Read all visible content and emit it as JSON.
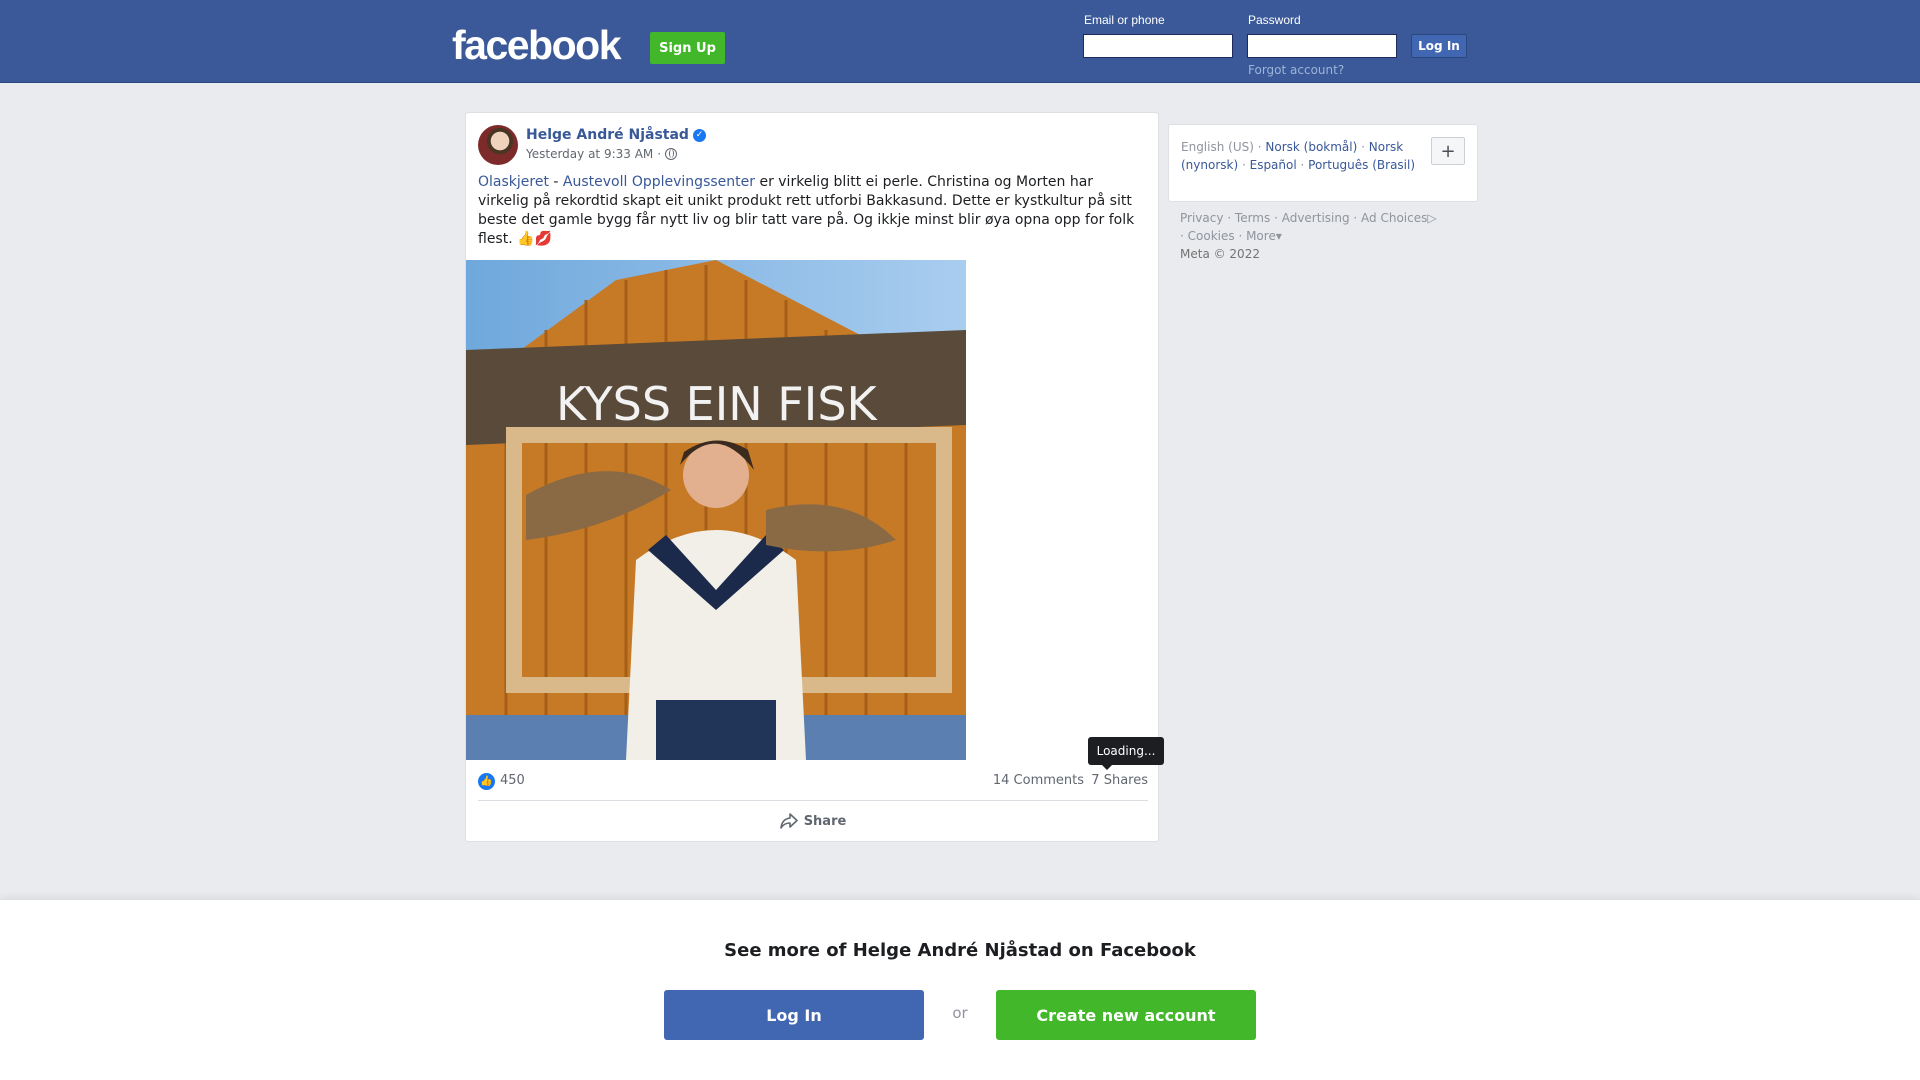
{
  "header": {
    "logo": "facebook",
    "signup_label": "Sign Up",
    "email_label": "Email or phone",
    "email_value": "",
    "password_label": "Password",
    "password_value": "",
    "login_label": "Log In",
    "forgot_label": "Forgot account?"
  },
  "post": {
    "author": "Helge André Njåstad",
    "verified_icon": "✓",
    "timestamp": "Yesterday at 9:33 AM",
    "meta_separator": "·",
    "text_link1": "Olaskjeret",
    "text_dash": " - ",
    "text_link2": "Austevoll Opplevingssenter",
    "text_body": " er virkelig blitt ei perle. Christina og Morten har virkelig på rekordtid skapt eit unikt produkt rett utforbi Bakkasund. Dette er kystkultur på sitt beste det gamle bygg får nytt liv og blir tatt vare på. Og ikkje minst blir øya opna opp for folk flest. 👍💋",
    "photo_sign_text": "KYSS EIN FISK",
    "tooltip": "Loading...",
    "like_icon": "👍",
    "likes": "450",
    "comments": "14 Comments",
    "shares": "7 Shares",
    "share_action": "Share"
  },
  "sidebar": {
    "languages": [
      {
        "label": "English (US)",
        "active": true
      },
      {
        "label": "Norsk (bokmål)",
        "active": false
      },
      {
        "label": "Norsk (nynorsk)",
        "active": false
      },
      {
        "label": "Español",
        "active": false
      },
      {
        "label": "Português (Brasil)",
        "active": false
      }
    ],
    "plus_label": "+",
    "footer": [
      "Privacy",
      "Terms",
      "Advertising",
      "Ad Choices",
      "Cookies",
      "More"
    ],
    "copyright": "Meta © 2022"
  },
  "banner": {
    "title": "See more of Helge André Njåstad on Facebook",
    "login_label": "Log In",
    "or_label": "or",
    "create_label": "Create new account"
  },
  "colors": {
    "brand_blue": "#3b5998",
    "link_blue": "#385898",
    "green": "#42b72a",
    "button_blue": "#4267b2"
  }
}
